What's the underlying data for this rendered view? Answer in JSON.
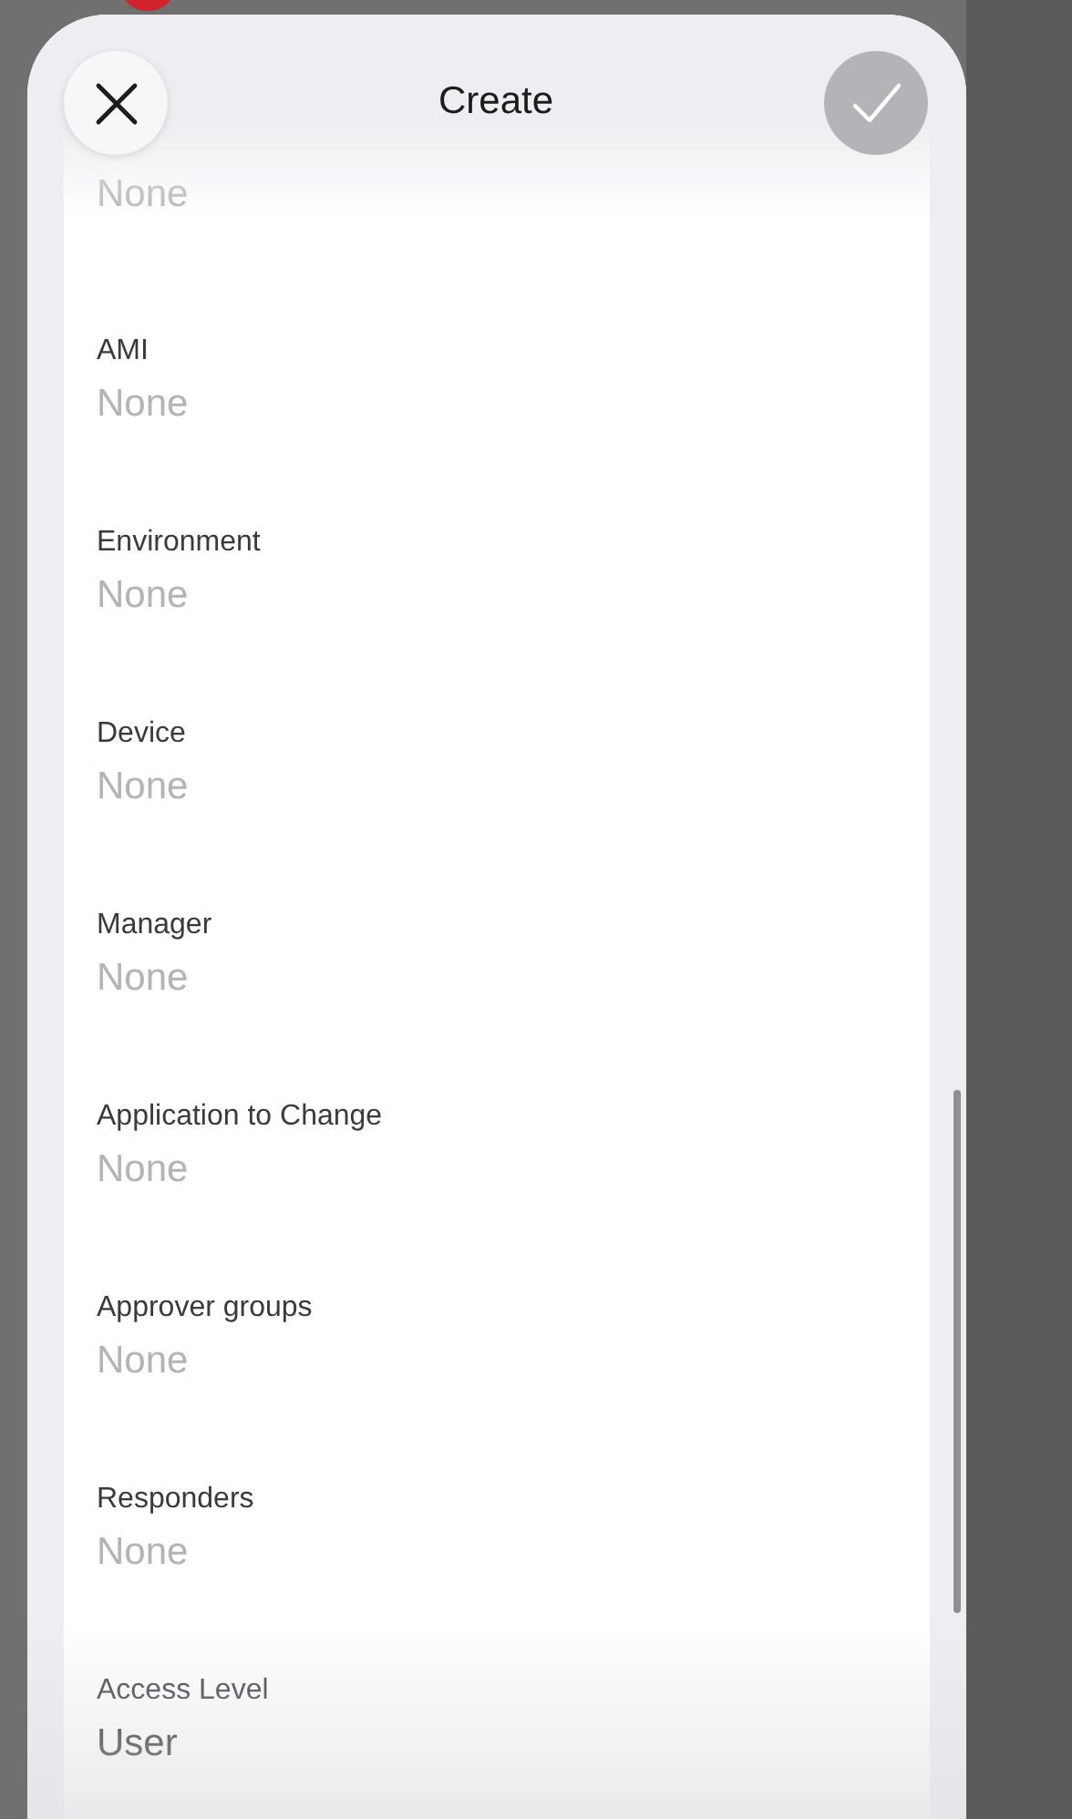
{
  "header": {
    "title": "Create"
  },
  "fields": [
    {
      "value": "None",
      "filled": false
    },
    {
      "label": "AMI",
      "value": "None",
      "filled": false
    },
    {
      "label": "Environment",
      "value": "None",
      "filled": false
    },
    {
      "label": "Device",
      "value": "None",
      "filled": false
    },
    {
      "label": "Manager",
      "value": "None",
      "filled": false
    },
    {
      "label": "Application to Change",
      "value": "None",
      "filled": false
    },
    {
      "label": "Approver groups",
      "value": "None",
      "filled": false
    },
    {
      "label": "Responders",
      "value": "None",
      "filled": false
    },
    {
      "label": "Access Level",
      "value": "User",
      "filled": true
    }
  ]
}
